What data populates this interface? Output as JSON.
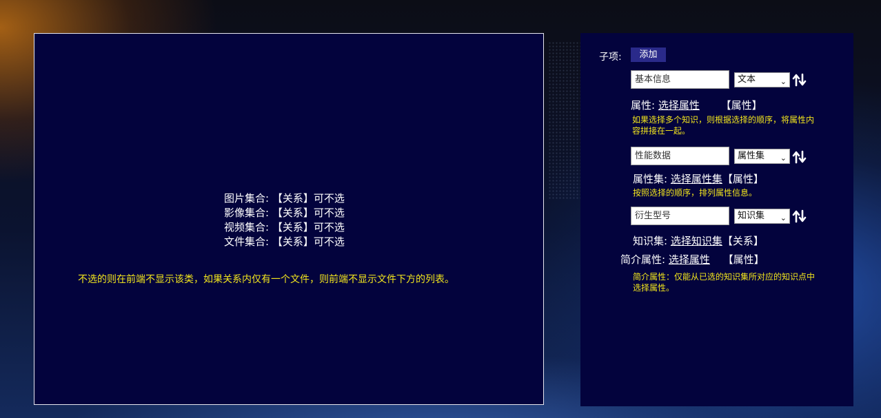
{
  "left": {
    "collections": [
      {
        "label": "图片集合:",
        "value": "【关系】可不选"
      },
      {
        "label": "影像集合:",
        "value": "【关系】可不选"
      },
      {
        "label": "视频集合:",
        "value": "【关系】可不选"
      },
      {
        "label": "文件集合:",
        "value": "【关系】可不选"
      }
    ],
    "note": "不选的则在前端不显示该类，如果关系内仅有一个文件，则前端不显示文件下方的列表。"
  },
  "right": {
    "sub_label": "子项:",
    "add_label": "添加",
    "items": [
      {
        "input_value": "基本信息",
        "select_value": "文本",
        "attr_label": "属性:",
        "attr_link": "选择属性",
        "attr_tag": "【属性】",
        "note_line1": "如果选择多个知识，则根据选择的顺序，将属性内",
        "note_line2": "容拼接在一起。"
      },
      {
        "input_value": "性能数据",
        "select_value": "属性集",
        "attr_label": "属性集:",
        "attr_link": "选择属性集",
        "attr_tag": "【属性】",
        "note_line1": "按照选择的顺序，排列属性信息。"
      },
      {
        "input_value": "衍生型号",
        "select_value": "知识集",
        "attr_label": "知识集:",
        "attr_link": "选择知识集",
        "attr_tag": "【关系】",
        "attr2_label": "简介属性:",
        "attr2_link": "选择属性",
        "attr2_tag": "【属性】",
        "note_line1": "简介属性：仅能从已选的知识集所对应的知识点中",
        "note_line2": "选择属性。"
      }
    ]
  },
  "icons": {
    "sort": "sort-arrows-icon",
    "caret": "chevron-down-icon"
  },
  "colors": {
    "panel_bg": "#03033d",
    "note": "#f2e51d",
    "button": "#2a2a8a"
  }
}
